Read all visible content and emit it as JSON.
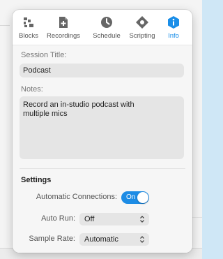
{
  "toolbar": {
    "tabs": [
      {
        "label": "Blocks",
        "icon": "blocks-icon"
      },
      {
        "label": "Recordings",
        "icon": "document-add-icon"
      },
      {
        "label": "Schedule",
        "icon": "clock-icon"
      },
      {
        "label": "Scripting",
        "icon": "diamond-icon"
      },
      {
        "label": "Info",
        "icon": "info-icon"
      }
    ],
    "active": "Info"
  },
  "session": {
    "title_label": "Session Title:",
    "title_value": "Podcast",
    "notes_label": "Notes:",
    "notes_value": "Record an in-studio podcast with\nmultiple mics"
  },
  "settings": {
    "heading": "Settings",
    "auto_connections_label": "Automatic Connections:",
    "auto_connections_value": "On",
    "auto_run_label": "Auto Run:",
    "auto_run_value": "Off",
    "sample_rate_label": "Sample Rate:",
    "sample_rate_value": "Automatic"
  },
  "colors": {
    "accent": "#1a8ee8",
    "toggle_on": "#1d8ce5",
    "backdrop": "#cfe7f6"
  }
}
